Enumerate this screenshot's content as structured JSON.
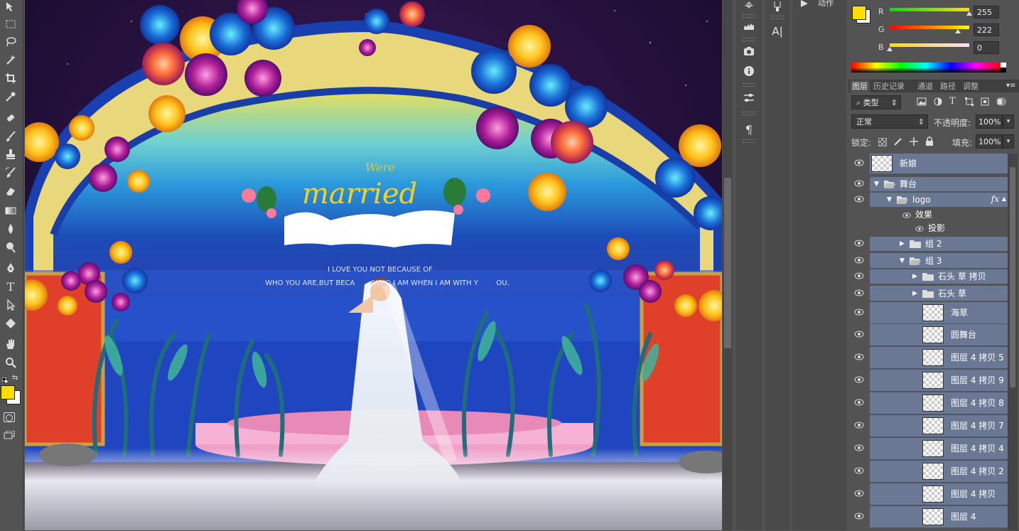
{
  "toolbar": {
    "tools": [
      "move-tool",
      "marquee-tool",
      "lasso-tool",
      "magic-wand-tool",
      "crop-tool",
      "eyedropper-tool",
      "healing-brush-tool",
      "brush-tool",
      "clone-stamp-tool",
      "history-brush-tool",
      "eraser-tool",
      "gradient-tool",
      "blur-tool",
      "dodge-tool",
      "pen-tool",
      "type-tool",
      "path-selection-tool",
      "shape-tool",
      "hand-tool",
      "zoom-tool"
    ],
    "foreground_color": "#ffde00",
    "background_color": "#ffffff"
  },
  "canvas": {
    "logo_text": "married",
    "logo_script_text": "Were",
    "quote_line1": "I LOVE YOU NOT BECAUSE OF",
    "quote_line2": "WHO YOU ARE,BUT BECA        WHO I AM WHEN I AM WITH Y        OU."
  },
  "dock": {
    "actions_label": "动作",
    "icons": [
      "lighting-effects-icon",
      "histogram-icon",
      "camera-icon",
      "info-icon",
      "adjustments-icon",
      "paragraph-icon",
      "brush-presets-icon",
      "character-icon"
    ]
  },
  "color_panel": {
    "r_label": "R",
    "g_label": "G",
    "b_label": "B",
    "r_value": "255",
    "g_value": "222",
    "b_value": "0",
    "fg_swatch": "#ffde00",
    "bg_swatch": "#ffffff"
  },
  "layers_panel": {
    "tabs": [
      "图层",
      "历史记录",
      "通道",
      "路径",
      "调整"
    ],
    "filter_kind": "类型",
    "blend_mode": "正常",
    "opacity_label": "不透明度:",
    "opacity_value": "100%",
    "lock_label": "锁定:",
    "fill_label": "填充:",
    "fill_value": "100%",
    "layers": [
      {
        "name": "新娘",
        "kind": "layer",
        "indent": 0
      },
      {
        "name": "舞台",
        "kind": "group-open",
        "indent": 0
      },
      {
        "name": "logo",
        "kind": "group-open",
        "indent": 1,
        "fx": "fx"
      },
      {
        "name": "效果",
        "kind": "effect",
        "indent": 2
      },
      {
        "name": "投影",
        "kind": "effect",
        "indent": 3
      },
      {
        "name": "组 2",
        "kind": "group-closed",
        "indent": 2
      },
      {
        "name": "组 3",
        "kind": "group-open",
        "indent": 2
      },
      {
        "name": "石头 草 拷贝",
        "kind": "group-closed",
        "indent": 3
      },
      {
        "name": "石头 草",
        "kind": "group-closed",
        "indent": 3
      },
      {
        "name": "海草",
        "kind": "layer",
        "indent": 3
      },
      {
        "name": "圆舞台",
        "kind": "layer",
        "indent": 3
      },
      {
        "name": "图层 4 拷贝 5",
        "kind": "layer",
        "indent": 3
      },
      {
        "name": "图层 4 拷贝 9",
        "kind": "layer",
        "indent": 3
      },
      {
        "name": "图层 4 拷贝 8",
        "kind": "layer",
        "indent": 3
      },
      {
        "name": "图层 4 拷贝 7",
        "kind": "layer",
        "indent": 3
      },
      {
        "name": "图层 4 拷贝 4",
        "kind": "layer",
        "indent": 3
      },
      {
        "name": "图层 4 拷贝 2",
        "kind": "layer",
        "indent": 3
      },
      {
        "name": "图层 4 拷贝",
        "kind": "layer",
        "indent": 3
      },
      {
        "name": "图层 4",
        "kind": "layer",
        "indent": 3
      }
    ]
  }
}
